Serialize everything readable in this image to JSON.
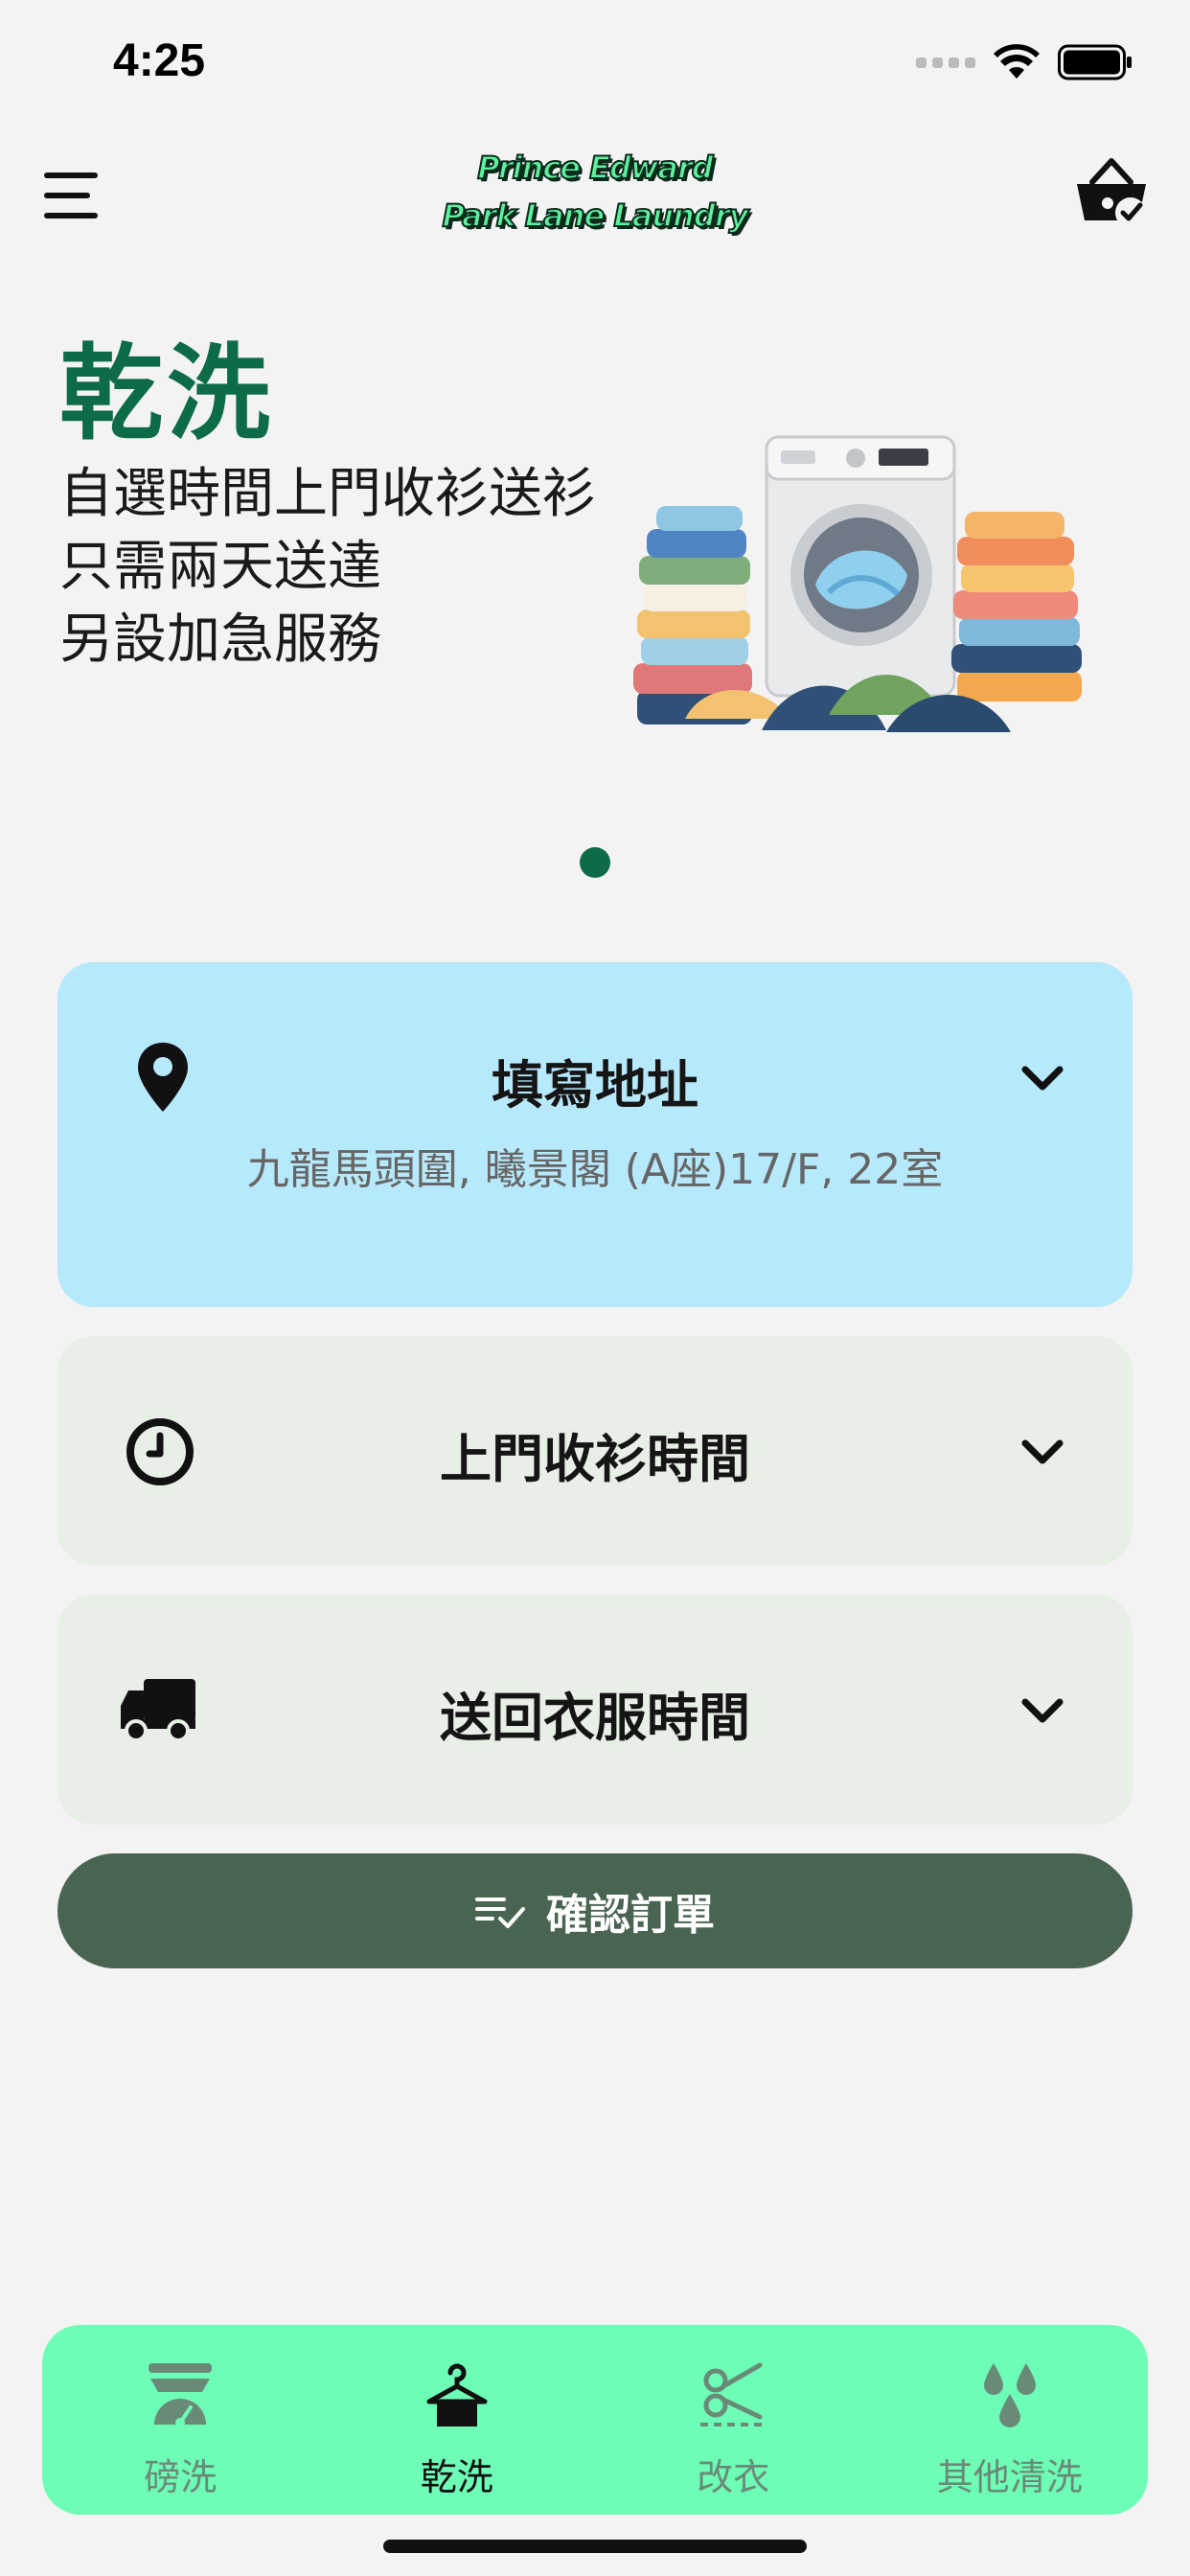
{
  "status_bar": {
    "time": "4:25"
  },
  "header": {
    "logo_line1": "Prince Edward",
    "logo_line2": "Park Lane Laundry",
    "menu_icon": "hamburger-menu-icon",
    "cart_icon": "shopping-basket-check-icon"
  },
  "hero": {
    "title": "乾洗",
    "lines": [
      "自選時間上門收衫送衫",
      "只需兩天送達",
      "另設加急服務"
    ],
    "image": "washing-machine-with-clothes-illustration",
    "page_count": 1,
    "active_page": 1
  },
  "cards": {
    "address": {
      "title": "填寫地址",
      "value": "九龍馬頭圍, 曦景閣 (A座)17/F, 22室",
      "icon": "location-pin-icon"
    },
    "pickup": {
      "title": "上門收衫時間",
      "icon": "clock-icon"
    },
    "return": {
      "title": "送回衣服時間",
      "icon": "truck-icon"
    }
  },
  "confirm": {
    "label": "確認訂單",
    "icon": "list-check-icon"
  },
  "tabs": [
    {
      "label": "磅洗",
      "icon": "scale-icon",
      "active": false
    },
    {
      "label": "乾洗",
      "icon": "hanger-icon",
      "active": true
    },
    {
      "label": "改衣",
      "icon": "scissors-icon",
      "active": false
    },
    {
      "label": "其他清洗",
      "icon": "water-drops-icon",
      "active": false
    }
  ],
  "colors": {
    "brand_green": "#0d6b48",
    "address_card": "#b6e9fb",
    "option_card": "#e8efe7",
    "confirm_button": "#4a6452",
    "tabbar": "#6dfdb6",
    "logo_green": "#5ef0a0"
  }
}
